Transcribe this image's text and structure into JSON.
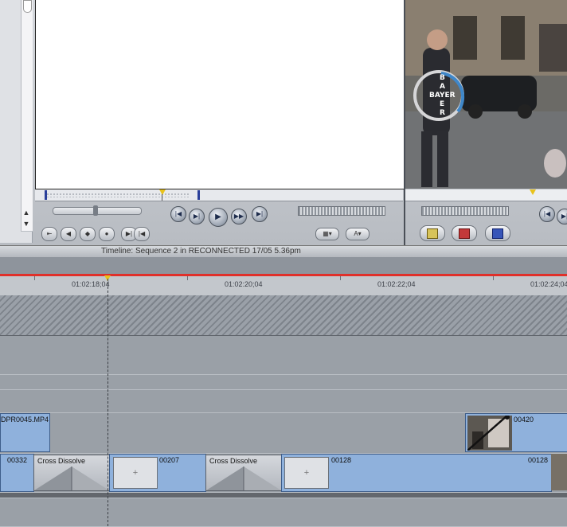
{
  "timeline": {
    "title": "Timeline: Sequence 2 in RECONNECTED 17/05 5.36pm",
    "ruler": {
      "timecodes": [
        "01:02:18;04",
        "01:02:20;04",
        "01:02:22;04",
        "01:02:24;04"
      ]
    },
    "upper_track": {
      "clips": [
        {
          "name": "DPR0045.MP4"
        },
        {
          "name": "00420"
        }
      ]
    },
    "main_track": {
      "clips": [
        {
          "name": "00332"
        },
        {
          "name": "Cross Dissolve",
          "kind": "transition"
        },
        {
          "name": "+",
          "kind": "gap"
        },
        {
          "name": "00207"
        },
        {
          "name": "Cross Dissolve",
          "kind": "transition"
        },
        {
          "name": "+",
          "kind": "gap"
        },
        {
          "name": "00128",
          "end_label": "00128"
        }
      ]
    }
  },
  "canvas": {
    "overlay_text": "BAYER"
  },
  "colors": {
    "clip_fill": "#8fb1dc",
    "playhead": "#e8c21c",
    "ruler_red": "#e0302a"
  }
}
